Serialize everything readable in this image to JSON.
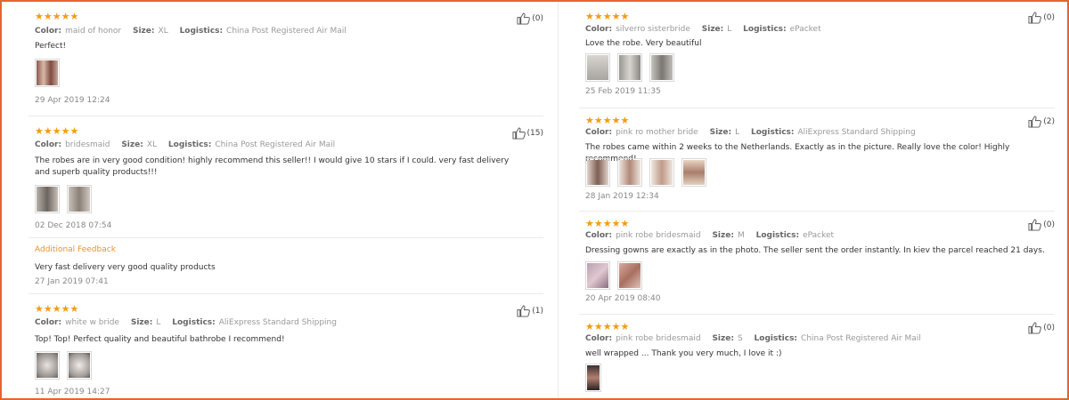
{
  "labels": {
    "color": "Color:",
    "size": "Size:",
    "logistics": "Logistics:",
    "stars": "★★★★★",
    "additional_feedback": "Additional Feedback"
  },
  "accent": "#e8632f",
  "star_color": "#f39c12",
  "icons": {
    "helpful": "thumbs-up-icon",
    "star": "star-icon"
  },
  "left_reviews": [
    {
      "color": "maid of honor",
      "size": "XL",
      "logistics": "China Post Registered Air Mail",
      "text": "Perfect!",
      "helpful": "(0)",
      "date": "29 Apr 2019 12:24",
      "images": 1
    },
    {
      "color": "bridesmaid",
      "size": "XL",
      "logistics": "China Post Registered Air Mail",
      "text": "The robes are in very good condition! highly recommend this seller!! I would give 10 stars if I could. very fast delivery and superb quality products!!!",
      "helpful": "(15)",
      "date": "02 Dec 2018 07:54",
      "images": 2,
      "additional": {
        "text": "Very fast delivery very good quality products",
        "date": "27 Jan 2019 07:41"
      }
    },
    {
      "color": "white w bride",
      "size": "L",
      "logistics": "AliExpress Standard Shipping",
      "text": "Top! Top! Perfect quality and beautiful bathrobe I recommend!",
      "helpful": "(1)",
      "date": "11 Apr 2019 14:27",
      "images": 2
    }
  ],
  "right_reviews": [
    {
      "color": "silverro sisterbride",
      "size": "L",
      "logistics": "ePacket",
      "text": "Love the robe. Very beautiful",
      "helpful": "(0)",
      "date": "25 Feb 2019 11:35",
      "images": 3
    },
    {
      "color": "pink ro mother bride",
      "size": "L",
      "logistics": "AliExpress Standard Shipping",
      "text": "The robes came within 2 weeks to the Netherlands. Exactly as in the picture. Really love the color! Highly recommend!",
      "helpful": "(2)",
      "date": "28 Jan 2019 12:34",
      "images": 4
    },
    {
      "color": "pink robe bridesmaid",
      "size": "M",
      "logistics": "ePacket",
      "text": "Dressing gowns are exactly as in the photo. The seller sent the order instantly. In kiev the parcel reached 21 days.",
      "helpful": "(0)",
      "date": "20 Apr 2019 08:40",
      "images": 2
    },
    {
      "color": "pink robe bridesmaid",
      "size": "S",
      "logistics": "China Post Registered Air Mail",
      "text": "well wrapped ... Thank you very much, I love it :)",
      "helpful": "(0)",
      "date": "",
      "images": 1
    }
  ]
}
